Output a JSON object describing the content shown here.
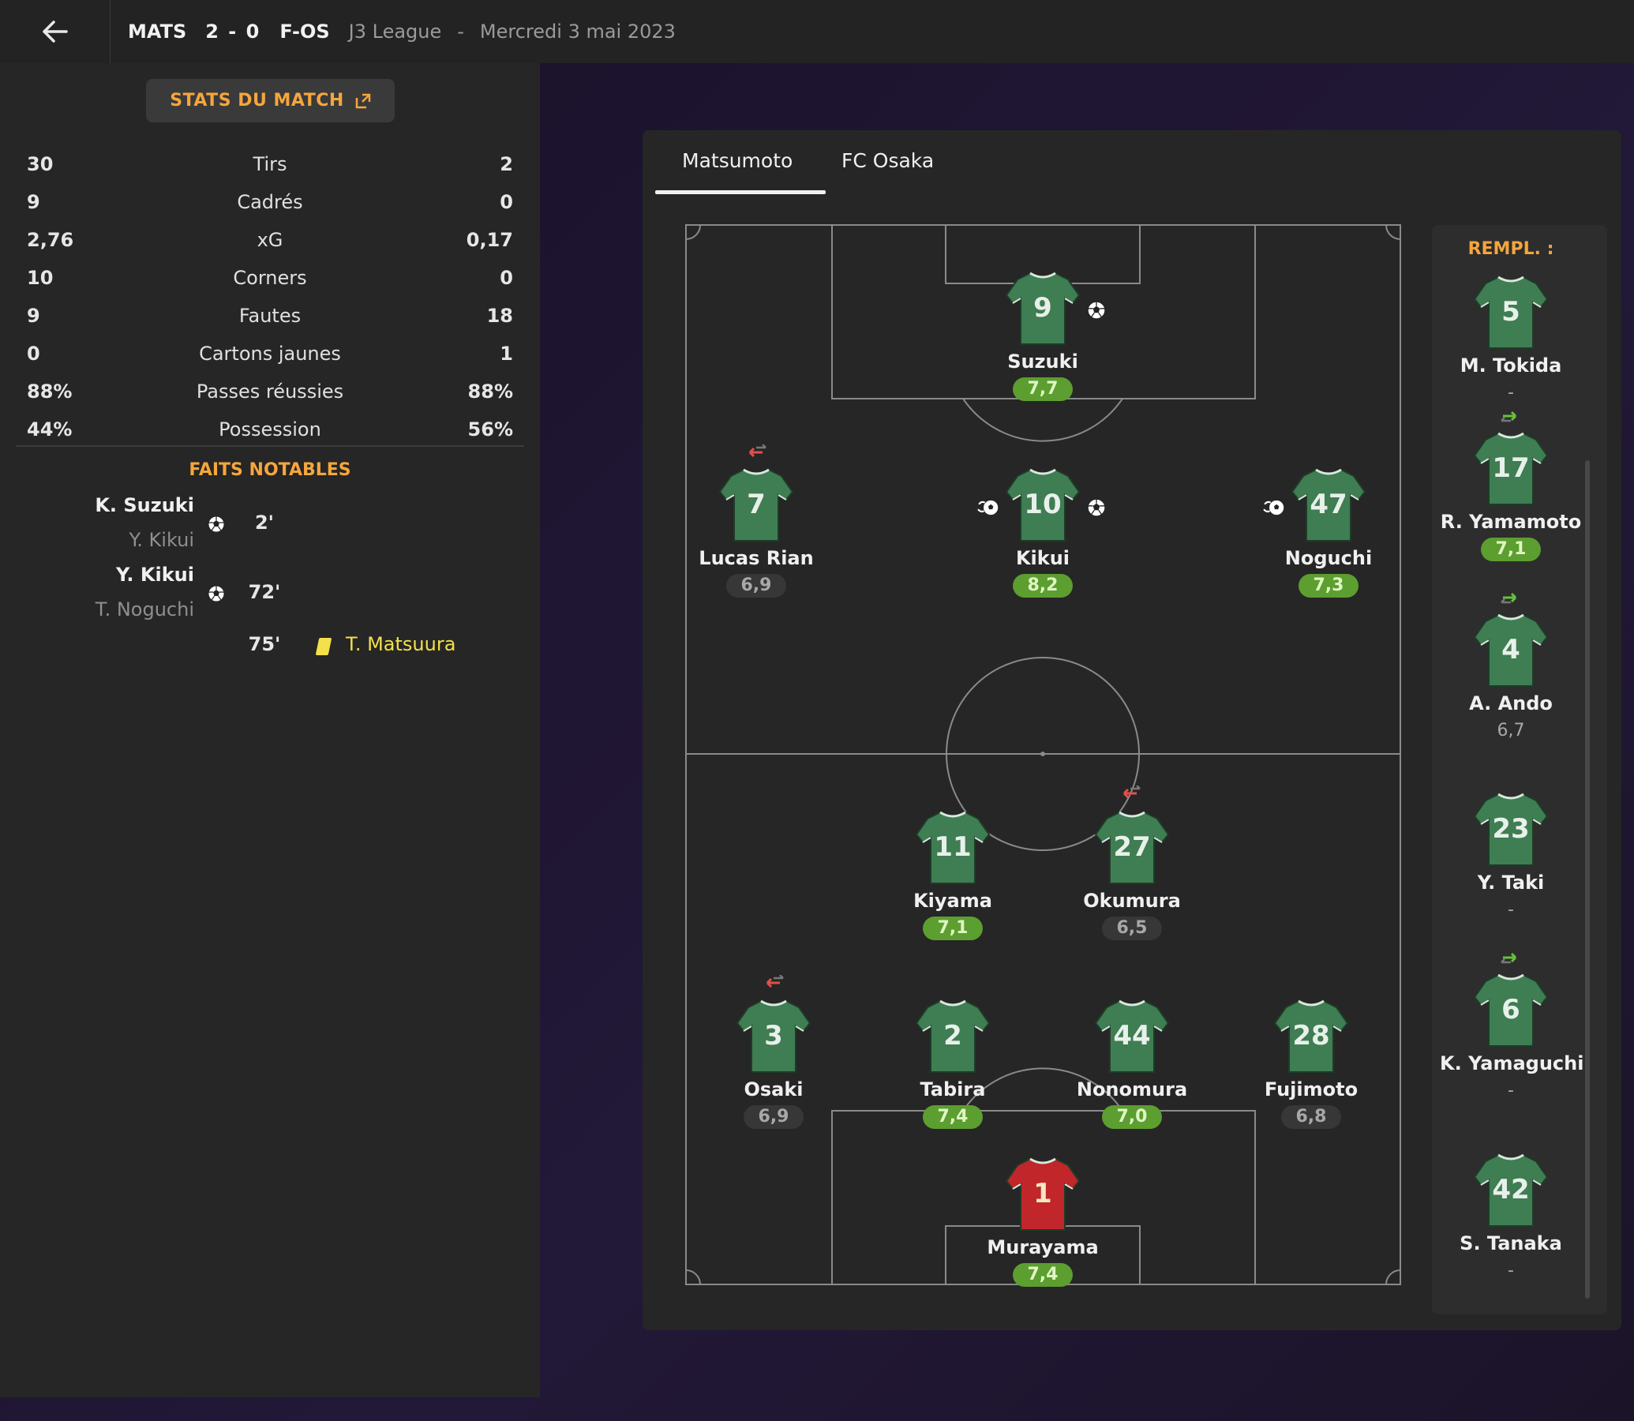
{
  "header": {
    "home_abbr": "MATS",
    "score": "2 - 0",
    "away_abbr": "F-OS",
    "league": "J3 League",
    "separator": "-",
    "date": "Mercredi 3 mai 2023"
  },
  "stats_button": {
    "label": "STATS DU MATCH"
  },
  "stats": [
    {
      "label": "Tirs",
      "home": "30",
      "away": "2"
    },
    {
      "label": "Cadrés",
      "home": "9",
      "away": "0"
    },
    {
      "label": "xG",
      "home": "2,76",
      "away": "0,17"
    },
    {
      "label": "Corners",
      "home": "10",
      "away": "0"
    },
    {
      "label": "Fautes",
      "home": "9",
      "away": "18"
    },
    {
      "label": "Cartons jaunes",
      "home": "0",
      "away": "1"
    },
    {
      "label": "Passes réussies",
      "home": "88%",
      "away": "88%"
    },
    {
      "label": "Possession",
      "home": "44%",
      "away": "56%"
    }
  ],
  "notable": {
    "title": "FAITS NOTABLES",
    "events": [
      {
        "scorer": "K. Suzuki",
        "assist": "Y. Kikui",
        "minute": "2'"
      },
      {
        "scorer": "Y. Kikui",
        "assist": "T. Noguchi",
        "minute": "72'"
      }
    ],
    "card": {
      "minute": "75'",
      "player": "T. Matsuura"
    }
  },
  "tabs": [
    "Matsumoto",
    "FC Osaka"
  ],
  "players": {
    "suzuki": {
      "num": "9",
      "name": "Suzuki",
      "rating": "7,7"
    },
    "rian": {
      "num": "7",
      "name": "Lucas Rian",
      "rating": "6,9"
    },
    "kikui": {
      "num": "10",
      "name": "Kikui",
      "rating": "8,2"
    },
    "noguchi": {
      "num": "47",
      "name": "Noguchi",
      "rating": "7,3"
    },
    "kiyama": {
      "num": "11",
      "name": "Kiyama",
      "rating": "7,1"
    },
    "okumura": {
      "num": "27",
      "name": "Okumura",
      "rating": "6,5"
    },
    "osaki": {
      "num": "3",
      "name": "Osaki",
      "rating": "6,9"
    },
    "tabira": {
      "num": "2",
      "name": "Tabira",
      "rating": "7,4"
    },
    "nonomura": {
      "num": "44",
      "name": "Nonomura",
      "rating": "7,0"
    },
    "fujimoto": {
      "num": "28",
      "name": "Fujimoto",
      "rating": "6,8"
    },
    "murayama": {
      "num": "1",
      "name": "Murayama",
      "rating": "7,4"
    }
  },
  "subs": {
    "title": "REMPL. :",
    "list": [
      {
        "num": "5",
        "name": "M. Tokida",
        "rating": "-"
      },
      {
        "num": "17",
        "name": "R. Yamamoto",
        "rating": "7,1"
      },
      {
        "num": "4",
        "name": "A. Ando",
        "rating": "6,7"
      },
      {
        "num": "23",
        "name": "Y. Taki",
        "rating": "-"
      },
      {
        "num": "6",
        "name": "K. Yamaguchi",
        "rating": "-"
      },
      {
        "num": "42",
        "name": "S. Tanaka",
        "rating": "-"
      }
    ]
  },
  "colors": {
    "accent": "#f5a63c",
    "rating_good": "#5c9e2f",
    "jersey": "#3f7d52",
    "keeper_jersey": "#c0262a",
    "yellow_card": "#f4e04a"
  },
  "icons": [
    "back-arrow-icon",
    "external-link-icon",
    "ball-icon",
    "yellow-card-icon",
    "sub-in-icon",
    "sub-out-icon",
    "assist-icon"
  ]
}
